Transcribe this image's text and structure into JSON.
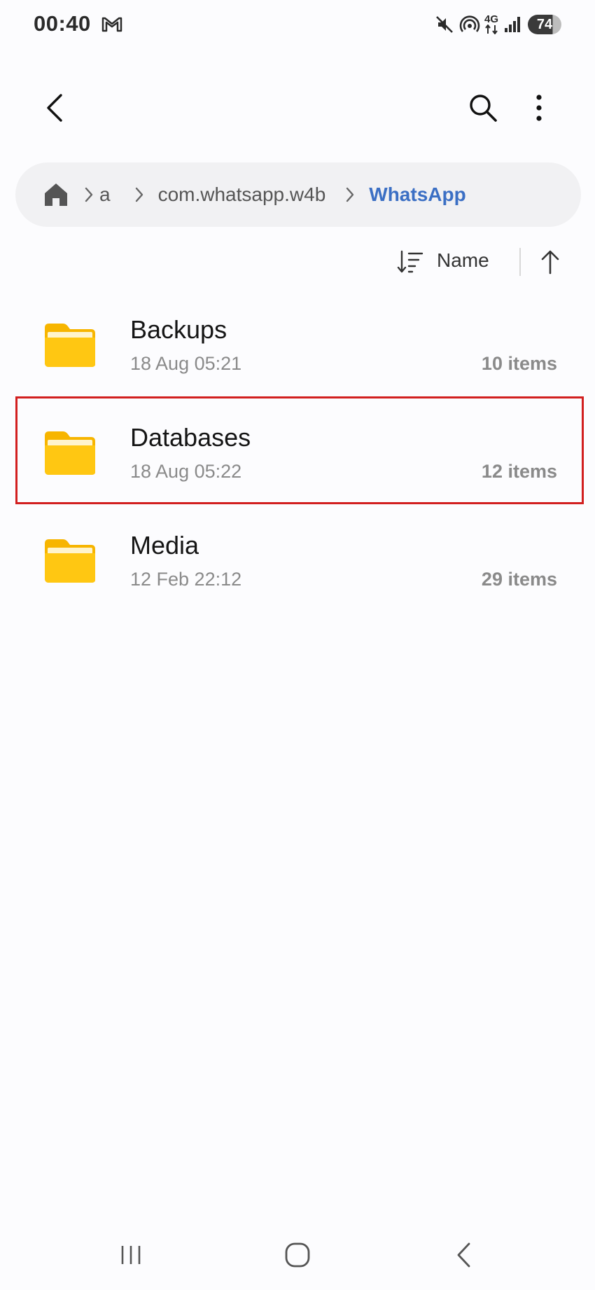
{
  "status_bar": {
    "time": "00:40",
    "network_label_top": "4G",
    "battery_level": "74",
    "icons": [
      "gmail-icon",
      "mute-icon",
      "hotspot-icon",
      "data-arrows-icon",
      "signal-icon",
      "battery-icon"
    ]
  },
  "app_bar": {
    "icons": [
      "back-arrow-icon",
      "search-icon",
      "more-vert-icon"
    ]
  },
  "breadcrumb": {
    "home_icon": "home-icon",
    "items": [
      {
        "label": "a"
      },
      {
        "label": "com.whatsapp.w4b"
      },
      {
        "label": "WhatsApp"
      }
    ],
    "current_color": "#3B6FC4"
  },
  "sort": {
    "label": "Name",
    "icons": [
      "sort-lines-icon",
      "arrow-up-icon"
    ]
  },
  "folders": [
    {
      "name": "Backups",
      "date": "18 Aug 05:21",
      "count": "10 items"
    },
    {
      "name": "Databases",
      "date": "18 Aug 05:22",
      "count": "12 items"
    },
    {
      "name": "Media",
      "date": "12 Feb 22:12",
      "count": "29 items"
    }
  ],
  "colors": {
    "folder_yellow": "#FFC107",
    "highlight_red": "#D21F1F",
    "accent_blue": "#3B6FC4"
  },
  "nav_bar": {
    "icons": [
      "recents-icon",
      "home-nav-icon",
      "back-nav-icon"
    ]
  }
}
